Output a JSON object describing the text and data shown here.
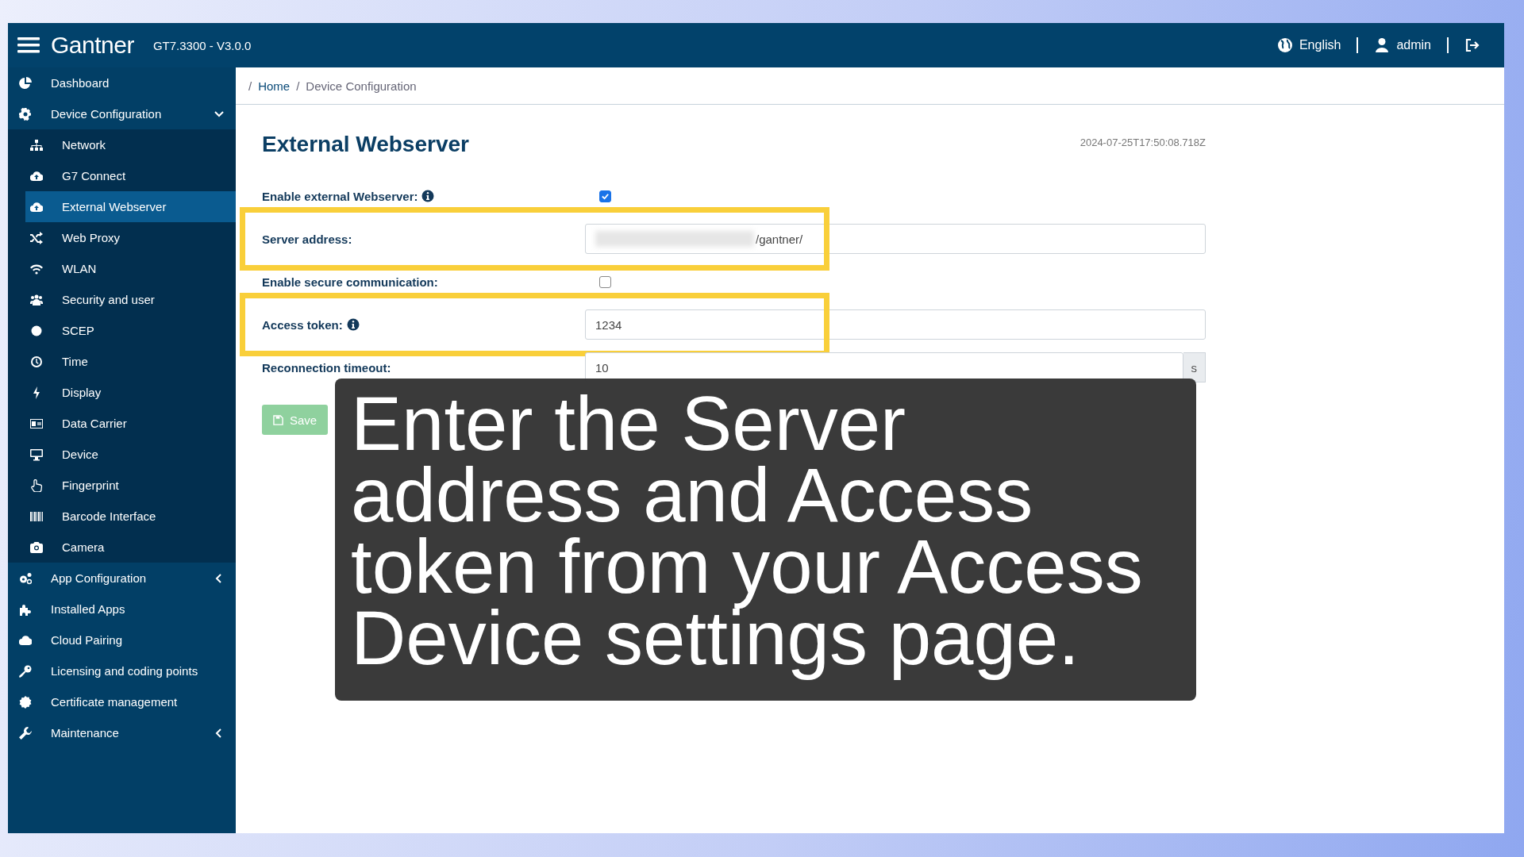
{
  "header": {
    "logo": "Gantner",
    "version": "GT7.3300 - V3.0.0",
    "language": "English",
    "user": "admin"
  },
  "sidebar": {
    "items": [
      {
        "label": "Dashboard",
        "selected": false
      },
      {
        "label": "Device Configuration",
        "selected": false,
        "expanded": true,
        "children": [
          {
            "label": "Network",
            "selected": false
          },
          {
            "label": "G7 Connect",
            "selected": false
          },
          {
            "label": "External Webserver",
            "selected": true
          },
          {
            "label": "Web Proxy",
            "selected": false
          },
          {
            "label": "WLAN",
            "selected": false
          },
          {
            "label": "Security and user",
            "selected": false
          },
          {
            "label": "SCEP",
            "selected": false
          },
          {
            "label": "Time",
            "selected": false
          },
          {
            "label": "Display",
            "selected": false
          },
          {
            "label": "Data Carrier",
            "selected": false
          },
          {
            "label": "Device",
            "selected": false
          },
          {
            "label": "Fingerprint",
            "selected": false
          },
          {
            "label": "Barcode Interface",
            "selected": false
          },
          {
            "label": "Camera",
            "selected": false
          }
        ]
      },
      {
        "label": "App Configuration",
        "selected": false,
        "expanded": false
      },
      {
        "label": "Installed Apps",
        "selected": false
      },
      {
        "label": "Cloud Pairing",
        "selected": false
      },
      {
        "label": "Licensing and coding points",
        "selected": false
      },
      {
        "label": "Certificate management",
        "selected": false
      },
      {
        "label": "Maintenance",
        "selected": false,
        "expanded": false
      }
    ]
  },
  "breadcrumb": [
    {
      "separator": "/",
      "label": "Home"
    },
    {
      "separator": "/",
      "label": "Device Configuration"
    }
  ],
  "page": {
    "title": "External Webserver",
    "timestamp": "2024-07-25T17:50:08.718Z"
  },
  "form": {
    "rows": [
      {
        "kind": "checkbox",
        "label": "Enable external Webserver:",
        "info": true,
        "checked": true,
        "highlighted": false
      },
      {
        "kind": "text",
        "label": "Server address:",
        "info": false,
        "value": "/gantner/",
        "redacted": true,
        "highlighted": true
      },
      {
        "kind": "checkbox",
        "label": "Enable secure communication:",
        "info": false,
        "checked": false,
        "highlighted": false
      },
      {
        "kind": "text",
        "label": "Access token:",
        "info": true,
        "value": "1234",
        "redacted": false,
        "highlighted": true
      },
      {
        "kind": "unit",
        "label": "Reconnection timeout:",
        "info": false,
        "value": "10",
        "unit": "s",
        "highlighted": false
      }
    ]
  },
  "buttons": [
    {
      "label": "Save",
      "disabled": true
    }
  ],
  "callout": {
    "text": "Enter the Server address and Access token from your Access Device settings page."
  }
}
